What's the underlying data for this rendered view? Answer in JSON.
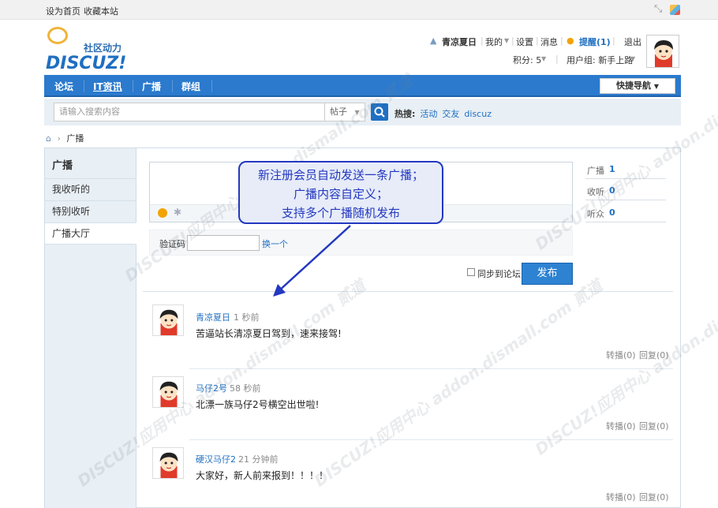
{
  "topbar": {
    "set_home": "设为首页",
    "bookmark": "收藏本站"
  },
  "logo": {
    "subtitle": "社区动力",
    "mark": "DISCUZ!"
  },
  "usernav": {
    "username": "青凉夏日",
    "my": "我的",
    "settings": "设置",
    "messages": "消息",
    "reminders": "提醒(1)",
    "logout": "退出",
    "points": "积分: 5",
    "usergroup": "用户组: 新手上路"
  },
  "nav": {
    "items": [
      "论坛",
      "IT资讯",
      "广播",
      "群组"
    ],
    "quick": "快捷导航"
  },
  "search": {
    "placeholder": "请输入搜索内容",
    "scope": "帖子",
    "hot_label": "热搜:",
    "hot": [
      "活动",
      "交友",
      "discuz"
    ]
  },
  "breadcrumb": {
    "current": "广播"
  },
  "sidebar": {
    "title": "广播",
    "items": [
      "我收听的",
      "特别收听",
      "广播大厅"
    ]
  },
  "composer": {
    "captcha_label": "验证码",
    "captcha_change": "换一个",
    "sync_label": "同步到论坛",
    "publish": "发布"
  },
  "stats": [
    {
      "label": "广播",
      "value": "1"
    },
    {
      "label": "收听",
      "value": "0"
    },
    {
      "label": "听众",
      "value": "0"
    }
  ],
  "callout": {
    "lines": [
      "新注册会员自动发送一条广播；",
      "广播内容自定义；",
      "支持多个广播随机发布"
    ]
  },
  "posts": [
    {
      "user": "青凉夏日",
      "time": "1 秒前",
      "text": "苦逼站长清凉夏日驾到，速来接驾!",
      "repost": "转播(0)",
      "reply": "回复(0)"
    },
    {
      "user": "马仔2号",
      "time": "58 秒前",
      "text": "北漂一族马仔2号横空出世啦!",
      "repost": "转播(0)",
      "reply": "回复(0)"
    },
    {
      "user": "硬汉马仔2",
      "time": "21 分钟前",
      "text": "大家好，新人前来报到！！！！",
      "repost": "转播(0)",
      "reply": "回复(0)"
    }
  ],
  "watermark": {
    "text": "DISCUZ!应用中心 addon.dismall.com 贰道"
  },
  "colors": {
    "accent": "#2b7acd",
    "callout": "#2338c0",
    "link": "#1f6fc2"
  }
}
